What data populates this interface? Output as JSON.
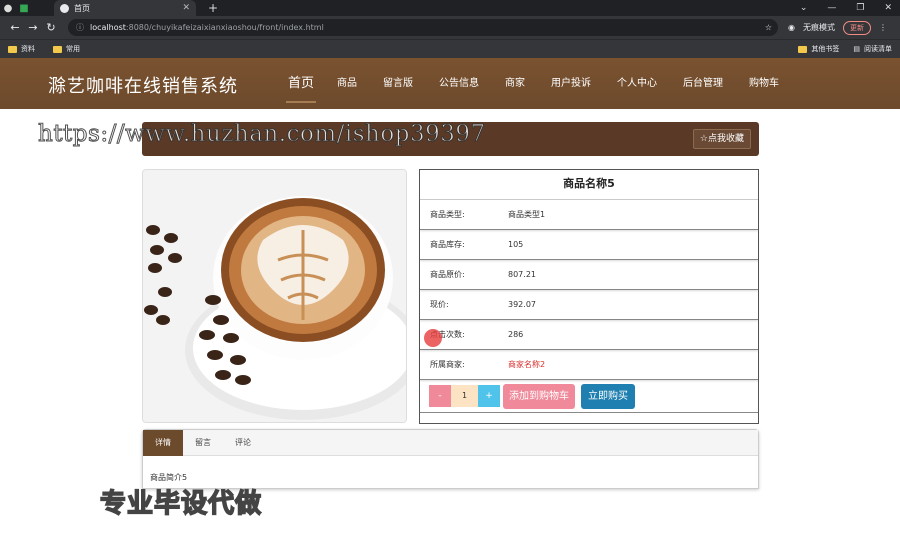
{
  "browser": {
    "tab_title": "首页",
    "url_host": "localhost",
    "url_rest": ":8080/chuyikafeizaixianxiaoshou/front/index.html",
    "incognito_label": "无痕模式",
    "update_label": "更新",
    "bookmarks": [
      "资料",
      "常用"
    ],
    "bookmarks_right": [
      "其他书签",
      "阅读清单"
    ]
  },
  "site": {
    "brand": "滁艺咖啡在线销售系统",
    "nav": [
      "首页",
      "商品",
      "留言版",
      "公告信息",
      "商家",
      "用户投诉",
      "个人中心",
      "后台管理",
      "购物车"
    ]
  },
  "banner": {
    "fav_label": "☆点我收藏"
  },
  "product": {
    "title": "商品名称5",
    "rows": [
      {
        "k": "商品类型:",
        "v": "商品类型1"
      },
      {
        "k": "商品库存:",
        "v": "105"
      },
      {
        "k": "商品原价:",
        "v": "807.21"
      },
      {
        "k": "现价:",
        "v": "392.07"
      },
      {
        "k": "点击次数:",
        "v": "286"
      },
      {
        "k": "所属商家:",
        "v": "商家名称2"
      }
    ],
    "qty": "1",
    "minus": "-",
    "plus": "+",
    "add_cart": "添加到购物车",
    "buy_now": "立即购买"
  },
  "tabs": {
    "items": [
      "详情",
      "留言",
      "评论"
    ],
    "content": "商品简介5"
  },
  "watermarks": {
    "url": "https://www.huzhan.com/ishop39397",
    "text": "专业毕设代做"
  }
}
